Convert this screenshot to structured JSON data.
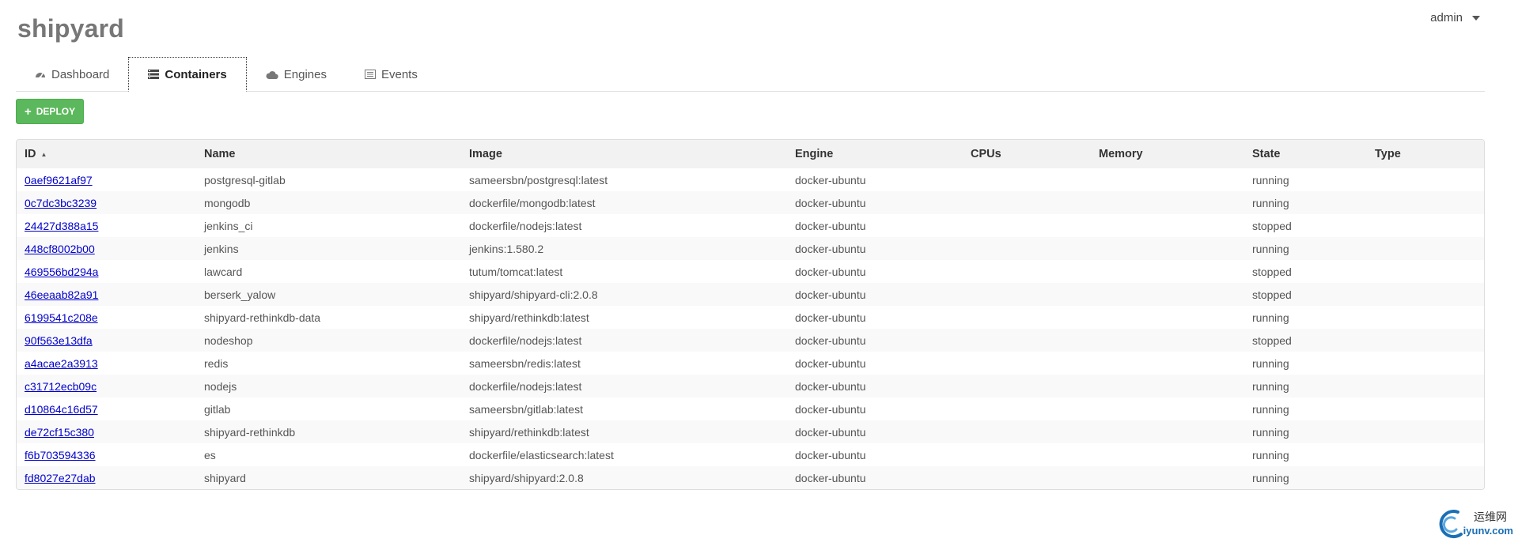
{
  "app": {
    "brand": "shipyard",
    "user": "admin"
  },
  "tabs": [
    {
      "label": "Dashboard",
      "icon": "dashboard-icon",
      "active": false
    },
    {
      "label": "Containers",
      "icon": "list-icon",
      "active": true
    },
    {
      "label": "Engines",
      "icon": "cloud-icon",
      "active": false
    },
    {
      "label": "Events",
      "icon": "events-icon",
      "active": false
    }
  ],
  "toolbar": {
    "deploy_label": "DEPLOY",
    "deploy_color": "#5cb85c"
  },
  "table": {
    "columns": {
      "id": "ID",
      "name": "Name",
      "image": "Image",
      "engine": "Engine",
      "cpus": "CPUs",
      "memory": "Memory",
      "state": "State",
      "type": "Type"
    },
    "sort_column": "ID",
    "rows": [
      {
        "id": "0aef9621af97",
        "name": "postgresql-gitlab",
        "image": "sameersbn/postgresql:latest",
        "engine": "docker-ubuntu",
        "cpus": "",
        "memory": "",
        "state": "running",
        "type": ""
      },
      {
        "id": "0c7dc3bc3239",
        "name": "mongodb",
        "image": "dockerfile/mongodb:latest",
        "engine": "docker-ubuntu",
        "cpus": "",
        "memory": "",
        "state": "running",
        "type": ""
      },
      {
        "id": "24427d388a15",
        "name": "jenkins_ci",
        "image": "dockerfile/nodejs:latest",
        "engine": "docker-ubuntu",
        "cpus": "",
        "memory": "",
        "state": "stopped",
        "type": ""
      },
      {
        "id": "448cf8002b00",
        "name": "jenkins",
        "image": "jenkins:1.580.2",
        "engine": "docker-ubuntu",
        "cpus": "",
        "memory": "",
        "state": "running",
        "type": ""
      },
      {
        "id": "469556bd294a",
        "name": "lawcard",
        "image": "tutum/tomcat:latest",
        "engine": "docker-ubuntu",
        "cpus": "",
        "memory": "",
        "state": "stopped",
        "type": ""
      },
      {
        "id": "46eeaab82a91",
        "name": "berserk_yalow",
        "image": "shipyard/shipyard-cli:2.0.8",
        "engine": "docker-ubuntu",
        "cpus": "",
        "memory": "",
        "state": "stopped",
        "type": ""
      },
      {
        "id": "6199541c208e",
        "name": "shipyard-rethinkdb-data",
        "image": "shipyard/rethinkdb:latest",
        "engine": "docker-ubuntu",
        "cpus": "",
        "memory": "",
        "state": "running",
        "type": ""
      },
      {
        "id": "90f563e13dfa",
        "name": "nodeshop",
        "image": "dockerfile/nodejs:latest",
        "engine": "docker-ubuntu",
        "cpus": "",
        "memory": "",
        "state": "stopped",
        "type": ""
      },
      {
        "id": "a4acae2a3913",
        "name": "redis",
        "image": "sameersbn/redis:latest",
        "engine": "docker-ubuntu",
        "cpus": "",
        "memory": "",
        "state": "running",
        "type": ""
      },
      {
        "id": "c31712ecb09c",
        "name": "nodejs",
        "image": "dockerfile/nodejs:latest",
        "engine": "docker-ubuntu",
        "cpus": "",
        "memory": "",
        "state": "running",
        "type": ""
      },
      {
        "id": "d10864c16d57",
        "name": "gitlab",
        "image": "sameersbn/gitlab:latest",
        "engine": "docker-ubuntu",
        "cpus": "",
        "memory": "",
        "state": "running",
        "type": ""
      },
      {
        "id": "de72cf15c380",
        "name": "shipyard-rethinkdb",
        "image": "shipyard/rethinkdb:latest",
        "engine": "docker-ubuntu",
        "cpus": "",
        "memory": "",
        "state": "running",
        "type": ""
      },
      {
        "id": "f6b703594336",
        "name": "es",
        "image": "dockerfile/elasticsearch:latest",
        "engine": "docker-ubuntu",
        "cpus": "",
        "memory": "",
        "state": "running",
        "type": ""
      },
      {
        "id": "fd8027e27dab",
        "name": "shipyard",
        "image": "shipyard/shipyard:2.0.8",
        "engine": "docker-ubuntu",
        "cpus": "",
        "memory": "",
        "state": "running",
        "type": ""
      }
    ]
  },
  "watermark": {
    "line1": "运维网",
    "line2": "iyunv.com"
  }
}
